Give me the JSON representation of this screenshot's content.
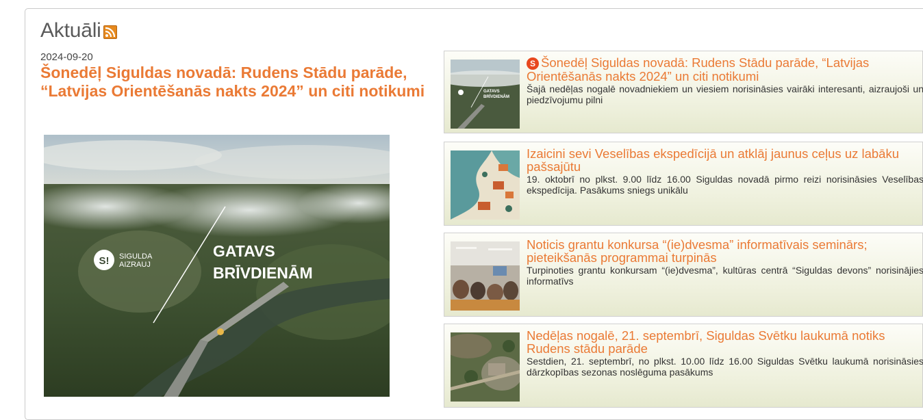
{
  "section": {
    "title": "Aktuāli",
    "rss_icon": "rss-icon",
    "accent": "#ea7a35"
  },
  "featured": {
    "date": "2024-09-20",
    "title": "Šonedēļ Siguldas novadā: Rudens Stādu parāde, “Latvijas Orientēšanās nakts 2024” un citi notikumi",
    "image": {
      "logo_mark": "S!",
      "logo_line1": "SIGULDA",
      "logo_line2": "AIZRAUJ",
      "headline_line1": "GATAVS",
      "headline_line2": "BRĪVDIENĀM"
    }
  },
  "news": [
    {
      "badge": "S",
      "title": "Šonedēļ Siguldas novadā: Rudens Stādu parāde, “Latvijas Orientēšanās nakts 2024” un citi notikumi",
      "summary": "Šajā nedēļas nogalē novadniekiem un viesiem norisināsies vairāki interesanti, aizraujoši un piedzīvojumu pilni",
      "thumb_text": "GATAVS BRĪVDIENĀM"
    },
    {
      "title": "Izaicini sevi Veselības ekspedīcijā un atklāj jaunus ceļus uz labāku pašsajūtu",
      "summary": "19. oktobrī no plkst. 9.00 līdz 16.00 Siguldas novadā pirmo reizi norisināsies Veselības ekspedīcija. Pasākums sniegs unikālu"
    },
    {
      "title": "Noticis grantu konkursa “(ie)dvesma” informatīvais seminārs; pieteikšanās programmai turpinās",
      "summary": "Turpinoties grantu konkursam “(ie)dvesma”, kultūras centrā “Siguldas devons” norisinājies informatīvs"
    },
    {
      "title": "Nedēļas nogalē, 21. septembrī, Siguldas Svētku laukumā notiks Rudens stādu parāde",
      "summary": "Sestdien, 21. septembrī, no plkst. 10.00 līdz 16.00 Siguldas Svētku laukumā norisināsies dārzkopības sezonas noslēguma pasākums"
    }
  ]
}
